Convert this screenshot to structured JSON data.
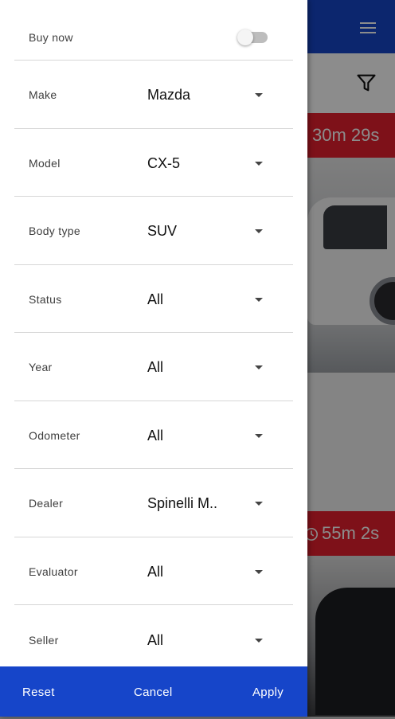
{
  "background": {
    "timers": [
      "30m 29s",
      "55m 2s"
    ]
  },
  "drawer": {
    "buy_now": {
      "label": "Buy now",
      "enabled": false
    },
    "filters": [
      {
        "label": "Make",
        "value": "Mazda"
      },
      {
        "label": "Model",
        "value": "CX-5"
      },
      {
        "label": "Body type",
        "value": "SUV"
      },
      {
        "label": "Status",
        "value": "All"
      },
      {
        "label": "Year",
        "value": "All"
      },
      {
        "label": "Odometer",
        "value": "All"
      },
      {
        "label": "Dealer",
        "value": "Spinelli M.."
      },
      {
        "label": "Evaluator",
        "value": "All"
      },
      {
        "label": "Seller",
        "value": "All"
      }
    ]
  },
  "footer": {
    "reset": "Reset",
    "cancel": "Cancel",
    "apply": "Apply"
  },
  "colors": {
    "primary": "#1645c9",
    "timer": "#e5202e"
  },
  "icons": {
    "menu": "hamburger-menu-icon",
    "filter": "funnel-filter-icon",
    "clock": "clock-icon",
    "dropdown": "caret-down-icon"
  }
}
